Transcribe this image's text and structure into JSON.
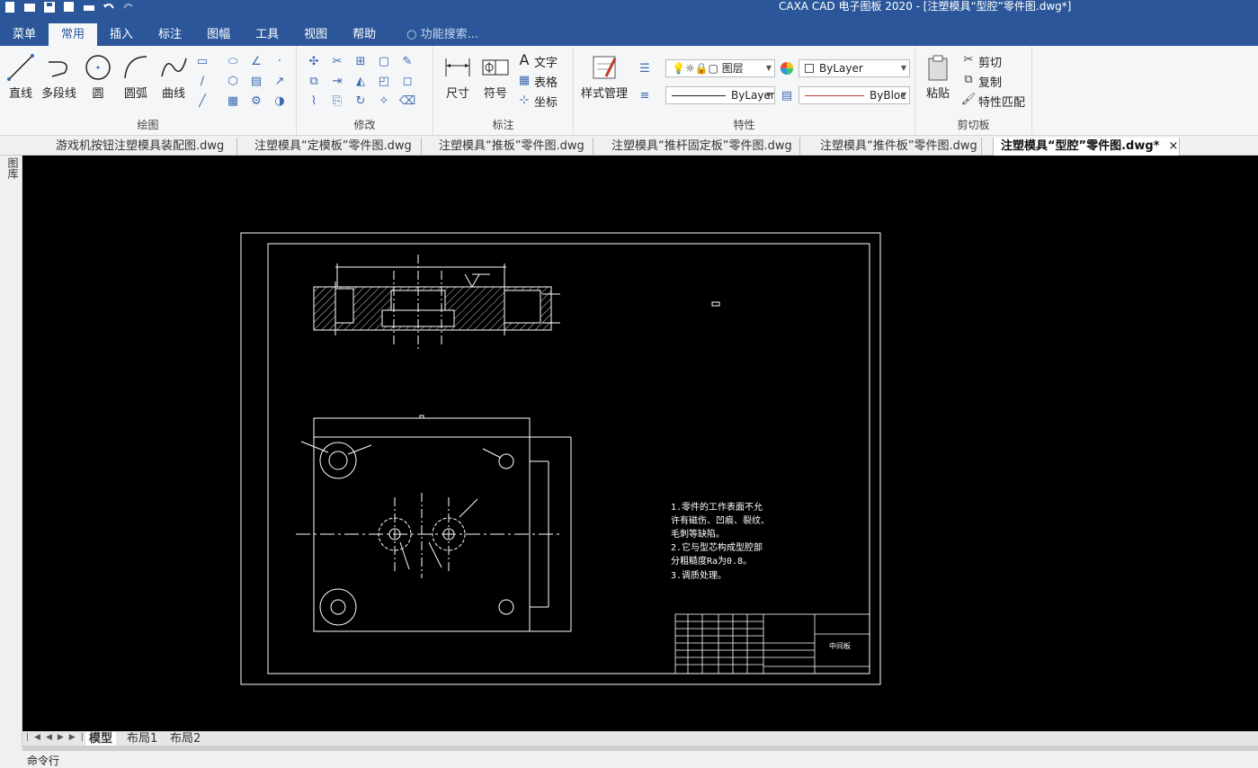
{
  "window": {
    "title": "CAXA CAD 电子图板 2020 - [注塑模具“型腔”零件图.dwg*]"
  },
  "ribbon_tabs": [
    "菜单",
    "常用",
    "插入",
    "标注",
    "图幅",
    "工具",
    "视图",
    "帮助"
  ],
  "active_tab": "常用",
  "search_placeholder": "功能搜索...",
  "draw_group": {
    "title": "绘图",
    "line": "直线",
    "polyline": "多段线",
    "circle": "圆",
    "arc": "圆弧",
    "curve": "曲线"
  },
  "modify_group": {
    "title": "修改"
  },
  "dim_group": {
    "title": "标注",
    "dimension": "尺寸",
    "symbol": "符号",
    "text": "文字",
    "table": "表格",
    "coordinate": "坐标"
  },
  "props_group": {
    "title": "特性",
    "style_manager": "样式管理",
    "layer": "图层",
    "color": "ByLayer",
    "linetype": "ByLayer",
    "lineweight": "ByBloc"
  },
  "clipboard_group": {
    "title": "剪切板",
    "paste": "粘贴",
    "cut": "剪切",
    "copy": "复制",
    "match": "特性匹配"
  },
  "left_panel_label": "图库",
  "doc_tabs": [
    "游戏机按钮注塑模具装配图.dwg",
    "注塑模具“定模板”零件图.dwg",
    "注塑模具“推板”零件图.dwg",
    "注塑模具“推杆固定板”零件图.dwg",
    "注塑模具“推件板”零件图.dwg",
    "注塑模具“型腔”零件图.dwg*"
  ],
  "active_doc": "注塑模具“型腔”零件图.dwg*",
  "drawing": {
    "notes": [
      "1.零件的工作表面不允",
      "许有磁伤、凹痕、裂纹、",
      "毛刺等缺陷。",
      "2.它与型芯构成型腔部",
      "分粗糙度Ra为0.8。",
      "3.调质处理。"
    ],
    "title_block_name": "中间板"
  },
  "layout_tabs": [
    "模型",
    "布局1",
    "布局2"
  ],
  "active_layout": "模型",
  "command_line": "命令行"
}
